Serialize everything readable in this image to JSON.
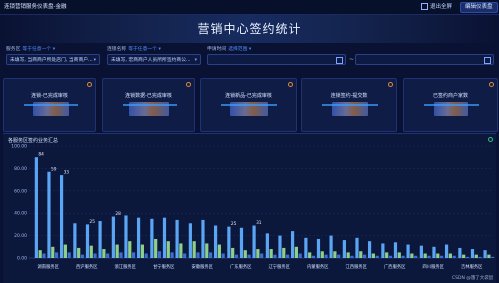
{
  "topbar": {
    "title": "连锁营销服务仪表盘-金融",
    "exit_label": "退出全屏",
    "edit_label": "编辑仪表盘"
  },
  "page_title": "营销中心签约统计",
  "filters": {
    "service_area": {
      "label": "服务区",
      "scope": "等于任意一个 ▾",
      "value": "未填写, 当商商户所处店门, 当商商户..."
    },
    "branch_name": {
      "label": "连锁名称",
      "scope": "等于任意一个 ▾",
      "value": "未填写, 宏商商户人员所所签约商公..."
    },
    "apply_time": {
      "label": "申请时间",
      "scope": "选择范围 ▾",
      "tilde": "~"
    }
  },
  "kpis": [
    {
      "title": "连锁-已完成审核"
    },
    {
      "title": "连锁数据-已完成审核"
    },
    {
      "title": "连锁新品-已完成审核"
    },
    {
      "title": "连锁签约-提交数"
    },
    {
      "title": "已签约商户家数"
    }
  ],
  "chart_panel": {
    "title": "各服务区签约业务汇总"
  },
  "chart_data": {
    "type": "bar",
    "title": "各服务区签约业务汇总",
    "y_tick_labels": [
      "0.00",
      "20.00",
      "40.00",
      "60.00",
      "80.00",
      "100.00"
    ],
    "ylim": [
      0,
      100
    ],
    "categories": [
      "湖南服务区",
      "西沪服务区",
      "浙江服务区",
      "甘宁服务区",
      "安徽服务区",
      "广东服务区",
      "辽宁服务区",
      "内蒙服务区",
      "江西服务区",
      "广西服务区",
      "四川服务区",
      "吉林服务区"
    ],
    "groups": [
      [
        [
          90,
          7,
          4
        ],
        [
          77,
          10,
          5
        ],
        [
          74,
          12,
          5
        ]
      ],
      [
        [
          31,
          9,
          3
        ],
        [
          30,
          11,
          4
        ],
        [
          33,
          8,
          4
        ]
      ],
      [
        [
          37,
          12,
          5
        ],
        [
          38,
          15,
          5
        ],
        [
          36,
          12,
          4
        ]
      ],
      [
        [
          35,
          17,
          6
        ],
        [
          36,
          15,
          5
        ],
        [
          34,
          13,
          4
        ]
      ],
      [
        [
          31,
          15,
          5
        ],
        [
          34,
          13,
          5
        ],
        [
          29,
          12,
          4
        ]
      ],
      [
        [
          28,
          9,
          3
        ],
        [
          27,
          7,
          3
        ],
        [
          29,
          8,
          4
        ]
      ],
      [
        [
          22,
          8,
          3
        ],
        [
          20,
          9,
          3
        ],
        [
          24,
          10,
          4
        ]
      ],
      [
        [
          18,
          5,
          2
        ],
        [
          17,
          6,
          3
        ],
        [
          20,
          6,
          3
        ]
      ],
      [
        [
          16,
          5,
          2
        ],
        [
          18,
          6,
          3
        ],
        [
          15,
          4,
          2
        ]
      ],
      [
        [
          13,
          5,
          2
        ],
        [
          14,
          5,
          2
        ],
        [
          12,
          4,
          2
        ]
      ],
      [
        [
          11,
          4,
          2
        ],
        [
          10,
          4,
          2
        ],
        [
          12,
          4,
          2
        ]
      ],
      [
        [
          9,
          3,
          1
        ],
        [
          8,
          3,
          1
        ],
        [
          7,
          3,
          1
        ]
      ]
    ],
    "data_labels": [
      {
        "text": "84",
        "group": 0,
        "bar": 0
      },
      {
        "text": "59",
        "group": 0,
        "bar": 1
      },
      {
        "text": "33",
        "group": 0,
        "bar": 2
      },
      {
        "text": "25",
        "group": 1,
        "bar": 1
      },
      {
        "text": "28",
        "group": 2,
        "bar": 0
      },
      {
        "text": "25",
        "group": 5,
        "bar": 0
      },
      {
        "text": "31",
        "group": 5,
        "bar": 2
      }
    ],
    "colors": {
      "primary": "#5aa6f5",
      "secondary": "#8ed08a",
      "tertiary": "#3b6fd6"
    },
    "grid": true,
    "legend": "none"
  },
  "watermark": "CSDN @饿了大袋鼠",
  "colors": {
    "background": "#0a1233",
    "panel": "#0f1c46",
    "accent": "#4f8cff",
    "info_orange": "#e0893a",
    "info_green": "#2ec27e"
  }
}
